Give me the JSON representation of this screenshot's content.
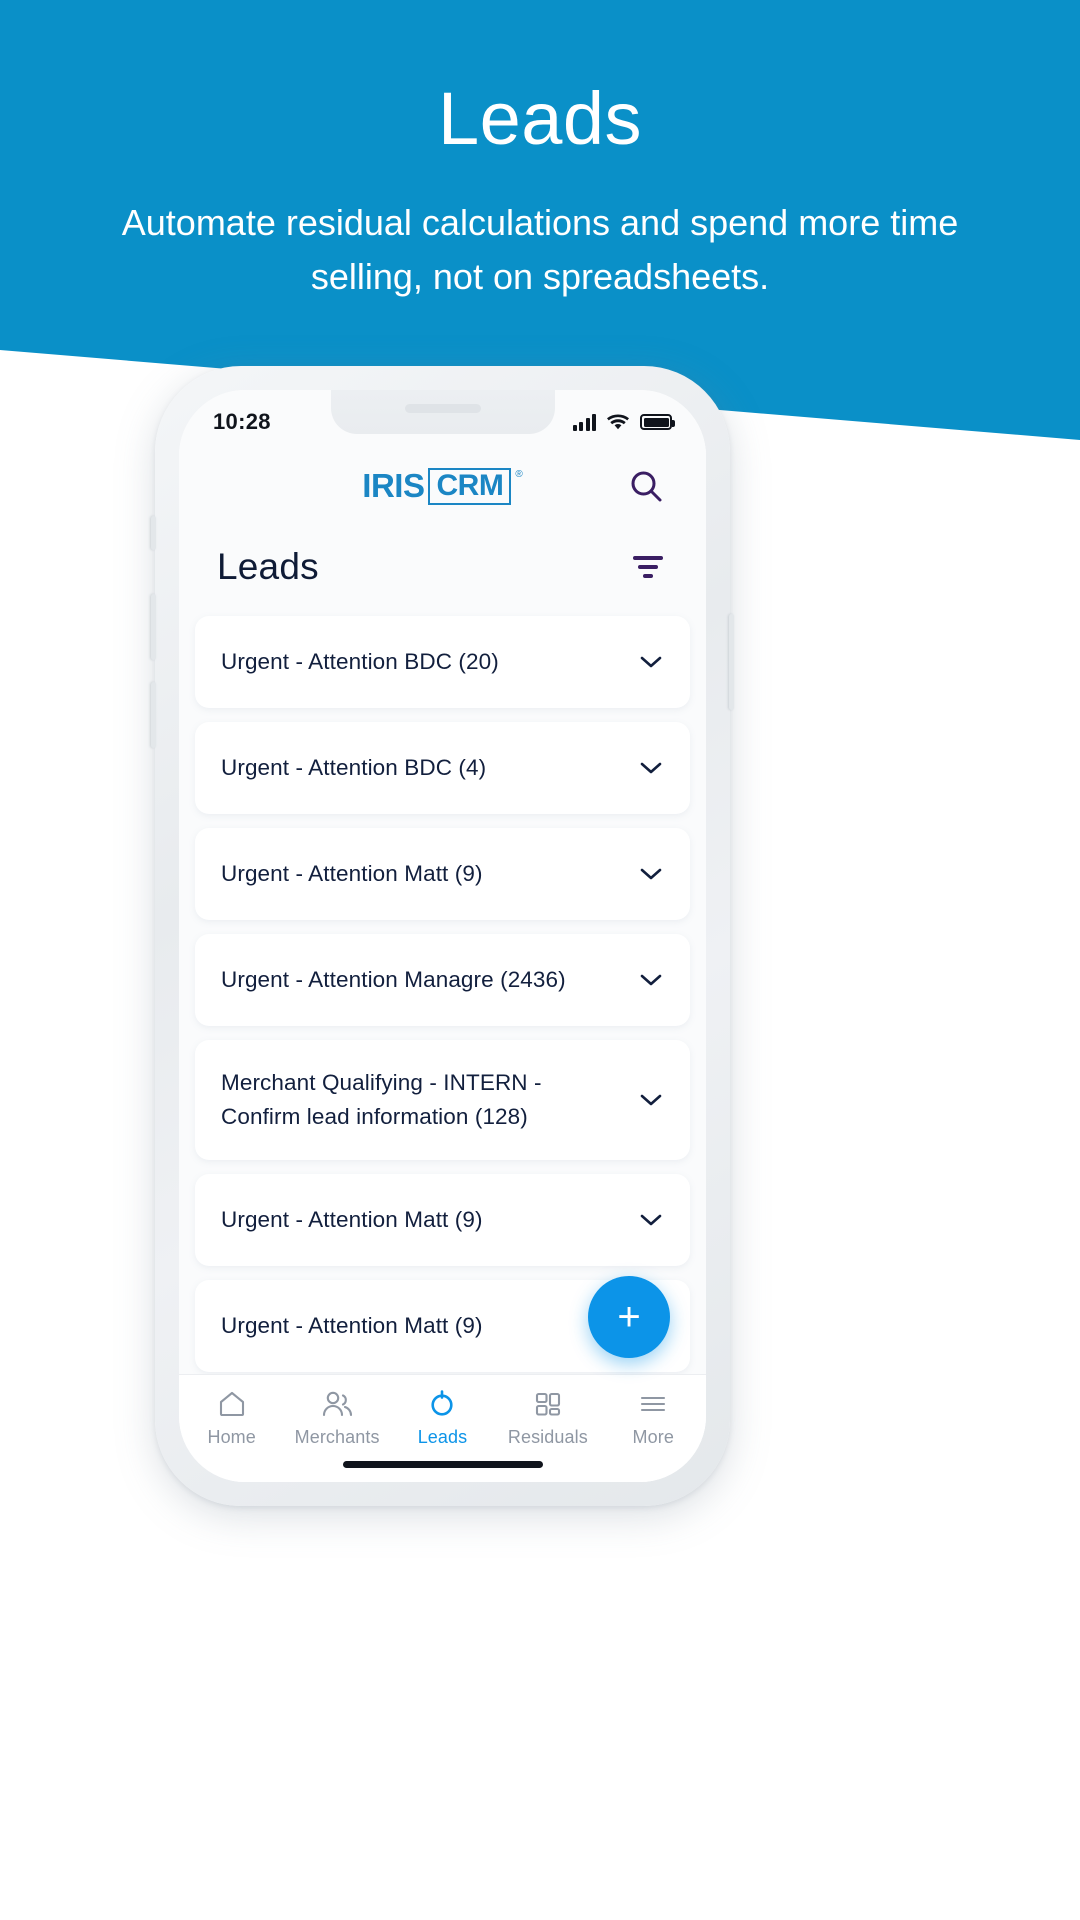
{
  "hero": {
    "title": "Leads",
    "subtitle": "Automate residual calculations and spend more time selling, not on spreadsheets.",
    "bg_color": "#0a90c8",
    "text_color": "#ffffff"
  },
  "phone": {
    "status_bar": {
      "time": "10:28",
      "signal_icon": "cellular-signal-icon",
      "wifi_icon": "wifi-icon",
      "battery_icon": "battery-full-icon"
    },
    "app_header": {
      "logo_primary": "IRIS",
      "logo_boxed": "CRM",
      "logo_registered": "®",
      "logo_color": "#1b86c4",
      "search_icon": "search-icon"
    },
    "page": {
      "title": "Leads",
      "filter_icon": "filter-icon",
      "filter_color": "#3a1e63",
      "title_color": "#0f1b36"
    },
    "leads": [
      {
        "label": "Urgent - Attention BDC (20)",
        "chevron": "chevron-down-icon"
      },
      {
        "label": "Urgent - Attention BDC (4)",
        "chevron": "chevron-down-icon"
      },
      {
        "label": "Urgent - Attention Matt (9)",
        "chevron": "chevron-down-icon"
      },
      {
        "label": "Urgent - Attention Managre (2436)",
        "chevron": "chevron-down-icon"
      },
      {
        "label": "Merchant Qualifying - INTERN - Confirm lead information (128)",
        "chevron": "chevron-down-icon"
      },
      {
        "label": "Urgent - Attention Matt (9)",
        "chevron": "chevron-down-icon"
      },
      {
        "label": "Urgent - Attention Matt (9)",
        "chevron": "chevron-down-icon"
      }
    ],
    "fab": {
      "label": "+",
      "icon": "plus-icon",
      "color": "#0c94e8"
    },
    "tabbar": {
      "active_color": "#0c94e8",
      "inactive_color": "#8f97a3",
      "items": [
        {
          "label": "Home",
          "icon": "home-icon",
          "active": false
        },
        {
          "label": "Merchants",
          "icon": "people-icon",
          "active": false
        },
        {
          "label": "Leads",
          "icon": "target-circle-icon",
          "active": true
        },
        {
          "label": "Residuals",
          "icon": "grid-squares-icon",
          "active": false
        },
        {
          "label": "More",
          "icon": "hamburger-menu-icon",
          "active": false
        }
      ]
    }
  }
}
